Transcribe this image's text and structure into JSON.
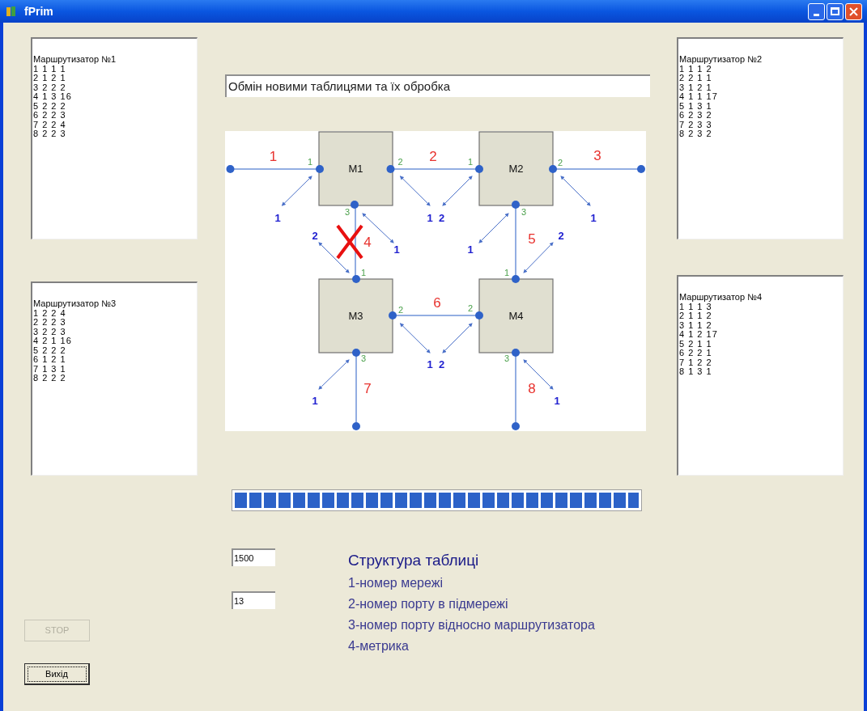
{
  "window": {
    "title": "fPrim"
  },
  "routing_tables": [
    {
      "title": "Маршрутизатор №1",
      "rows": [
        "1 1 1 1",
        "2 1 2 1",
        "3 2 2 2",
        "4 1 3 16",
        "5 2 2 2",
        "6 2 2 3",
        "7 2 2 4",
        "8 2 2 3"
      ]
    },
    {
      "title": "Маршрутизатор №3",
      "rows": [
        "1 2 2 4",
        "2 2 2 3",
        "3 2 2 3",
        "4 2 1 16",
        "5 2 2 2",
        "6 1 2 1",
        "7 1 3 1",
        "8 2 2 2"
      ]
    },
    {
      "title": "Маршрутизатор №2",
      "rows": [
        "1 1 1 2",
        "2 2 1 1",
        "3 1 2 1",
        "4 1 1 17",
        "5 1 3 1",
        "6 2 3 2",
        "7 2 3 3",
        "8 2 3 2"
      ]
    },
    {
      "title": "Маршрутизатор №4",
      "rows": [
        "1 1 1 3",
        "2 1 1 2",
        "3 1 1 2",
        "4 1 2 17",
        "5 2 1 1",
        "6 2 2 1",
        "7 1 2 2",
        "8 1 3 1"
      ]
    }
  ],
  "status_field": {
    "value": "Обмін новими таблицями та їх обробка"
  },
  "network_diagram": {
    "routers": [
      "M1",
      "M2",
      "M3",
      "M4"
    ],
    "networks": [
      {
        "label": "1",
        "failed": false
      },
      {
        "label": "2",
        "failed": false
      },
      {
        "label": "3",
        "failed": false
      },
      {
        "label": "4",
        "failed": true
      },
      {
        "label": "5",
        "failed": false
      },
      {
        "label": "6",
        "failed": false
      },
      {
        "label": "7",
        "failed": false
      },
      {
        "label": "8",
        "failed": false
      }
    ],
    "port_labels": [
      "1",
      "2",
      "3",
      "1",
      "2",
      "3",
      "1",
      "2",
      "3",
      "1",
      "2",
      "3"
    ],
    "interface_labels": [
      "1",
      "1",
      "2",
      "1",
      "2",
      "1",
      "1",
      "2",
      "1",
      "2",
      "1",
      "1"
    ]
  },
  "progress": {
    "level": 1
  },
  "fields": [
    "1500",
    "13"
  ],
  "legend": {
    "title": "Структура таблиці",
    "items": [
      "1-номер мережі",
      "2-номер порту в підмережі",
      "3-номер порту відносно маршрутизатора",
      "4-метрика"
    ]
  },
  "buttons": [
    {
      "label": "STOP",
      "disabled": true
    },
    {
      "label": "Вихід",
      "disabled": false
    }
  ]
}
